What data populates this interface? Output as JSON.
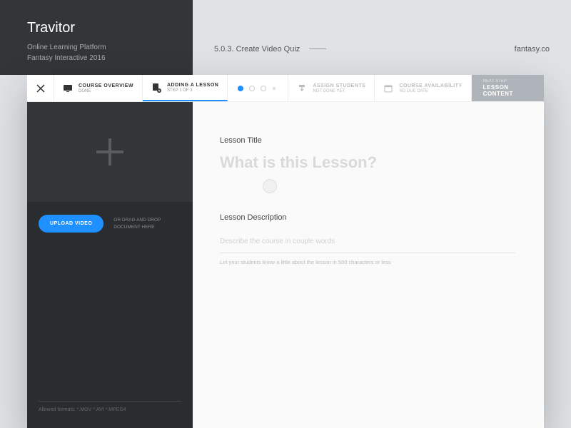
{
  "header": {
    "brand_title": "Travitor",
    "subtitle_1": "Online Learning Platform",
    "subtitle_2": "Fantasy Interactive 2016",
    "breadcrumb": "5.0.3. Create Video Quiz",
    "external_brand": "fantasy.co"
  },
  "steps": {
    "overview": {
      "title": "COURSE OVERVIEW",
      "sub": "DONE"
    },
    "adding": {
      "title": "ADDING A LESSON",
      "sub": "STEP 1 OF 3"
    },
    "assign": {
      "title": "ASSIGN STUDENTS",
      "sub": "NOT DONE YET"
    },
    "avail": {
      "title": "COURSE AVAILABILITY",
      "sub": "NO DUE DATE"
    },
    "next": {
      "sup": "NEXT STEP",
      "title": "LESSON CONTENT"
    }
  },
  "left": {
    "upload_btn": "UPLOAD VIDEO",
    "drag_1": "OR DRAG AND DROP",
    "drag_2": "DOCUMENT HERE",
    "formats": "Allowed formats: *.MOV  *.AVI  *.MPEG4"
  },
  "form": {
    "title_label": "Lesson Title",
    "title_placeholder": "What is this Lesson?",
    "desc_label": "Lesson Description",
    "desc_placeholder": "Describe the course in couple words",
    "desc_hint": "Let your students know a little about the lesson in 500 characters or less"
  }
}
